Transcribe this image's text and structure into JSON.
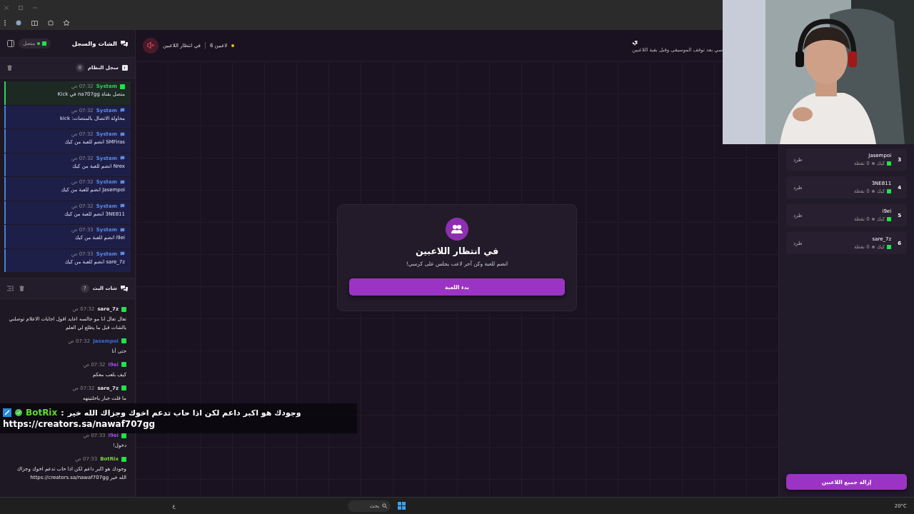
{
  "left_panel": {
    "title": "الشات والسجل",
    "status": "متصل",
    "system_log": {
      "title": "سجل النظام",
      "count": "8",
      "entries": [
        {
          "kind": "kick",
          "source": "System",
          "time": "07:32 ص",
          "message": "متصل بقناة na707gg في Kick"
        },
        {
          "kind": "system",
          "source": "System",
          "time": "07:32 ص",
          "message": "محاولة الاتصال بالمنصات: kick"
        },
        {
          "kind": "system",
          "source": "System",
          "time": "07:32 ص",
          "message": "SMFiras انضم للعبة من كيك"
        },
        {
          "kind": "system",
          "source": "System",
          "time": "07:32 ص",
          "message": "Nrex انضم للعبة من كيك"
        },
        {
          "kind": "system",
          "source": "System",
          "time": "07:32 ص",
          "message": "Jasempoi انضم للعبة من كيك"
        },
        {
          "kind": "system",
          "source": "System",
          "time": "07:32 ص",
          "message": "3NE811 انضم للعبة من كيك"
        },
        {
          "kind": "system",
          "source": "System",
          "time": "07:33 ص",
          "message": "i9ei انضم للعبة من كيك"
        },
        {
          "kind": "system",
          "source": "System",
          "time": "07:33 ص",
          "message": "sare_7z انضم للعبة من كيك"
        }
      ]
    },
    "stream_chat": {
      "title": "شات البث",
      "count": "7",
      "messages": [
        {
          "kind": "message",
          "user": "sare_7z",
          "color": "#e6e6ea",
          "time": "07:32 ص",
          "text": "تعال تعال انا مو جالسه اعايد اقول اجابات الاعلام توصلني بالشات قبل ما يطلع لي العلم"
        },
        {
          "kind": "message",
          "user": "Jasempoi",
          "color": "#3a6fd6",
          "time": "07:32 ص",
          "text": "حتى أنا"
        },
        {
          "kind": "message",
          "user": "i9ei",
          "color": "#a24ee8",
          "time": "07:32 ص",
          "text": "كيف بلعب معكم"
        },
        {
          "kind": "message",
          "user": "sare_7z",
          "color": "#e6e6ea",
          "time": "07:32 ص",
          "text": "ما قلت جبار ياحلتيتهه"
        },
        {
          "kind": "covered"
        },
        {
          "kind": "message",
          "user": "i9ei",
          "color": "#a24ee8",
          "time": "07:33 ص",
          "text": "دخول!"
        },
        {
          "kind": "message",
          "user": "BotRix",
          "color": "#7ad83a",
          "time": "07:33 ص",
          "text": "وجودك هو اكبر داعم لكن اذا حاب تدعم اخوك وجزاك الله خير https://creators.sa/nawaf707gg"
        }
      ]
    }
  },
  "game_header": {
    "title": "ي",
    "subtitle": "سي بعد توقف الموسيقى وقبل بقية اللاعبين",
    "players": "6 لاعبين",
    "state": "في انتظار اللاعبين"
  },
  "waiting_card": {
    "title": "في انتظار اللاعبين",
    "subtitle": "انضم للعبة وكن آخر لاعب يجلس على كرسي!",
    "button": "بدء اللعبة"
  },
  "players": [
    {
      "number": "3",
      "name": "Jasempoi",
      "platform": "كيك",
      "points": "0 نقطة",
      "action": "طرد"
    },
    {
      "number": "4",
      "name": "3NE811",
      "platform": "كيك",
      "points": "0 نقطة",
      "action": "طرد"
    },
    {
      "number": "5",
      "name": "i9ei",
      "platform": "كيك",
      "points": "0 نقطة",
      "action": "طرد"
    },
    {
      "number": "6",
      "name": "sare_7z",
      "platform": "كيك",
      "points": "0 نقطة",
      "action": "طرد"
    }
  ],
  "remove_all_button": "إزالة جميع اللاعبين",
  "chat_banner": {
    "user": "BotRix",
    "separator": ":",
    "message": "وجودك هو اكبر داعم لكن اذا حاب تدعم اخوك وجزاك الله خير",
    "link": "https://creators.sa/nawaf707gg"
  },
  "taskbar": {
    "search": "بحث",
    "language": "ع",
    "weather": "20°C"
  }
}
